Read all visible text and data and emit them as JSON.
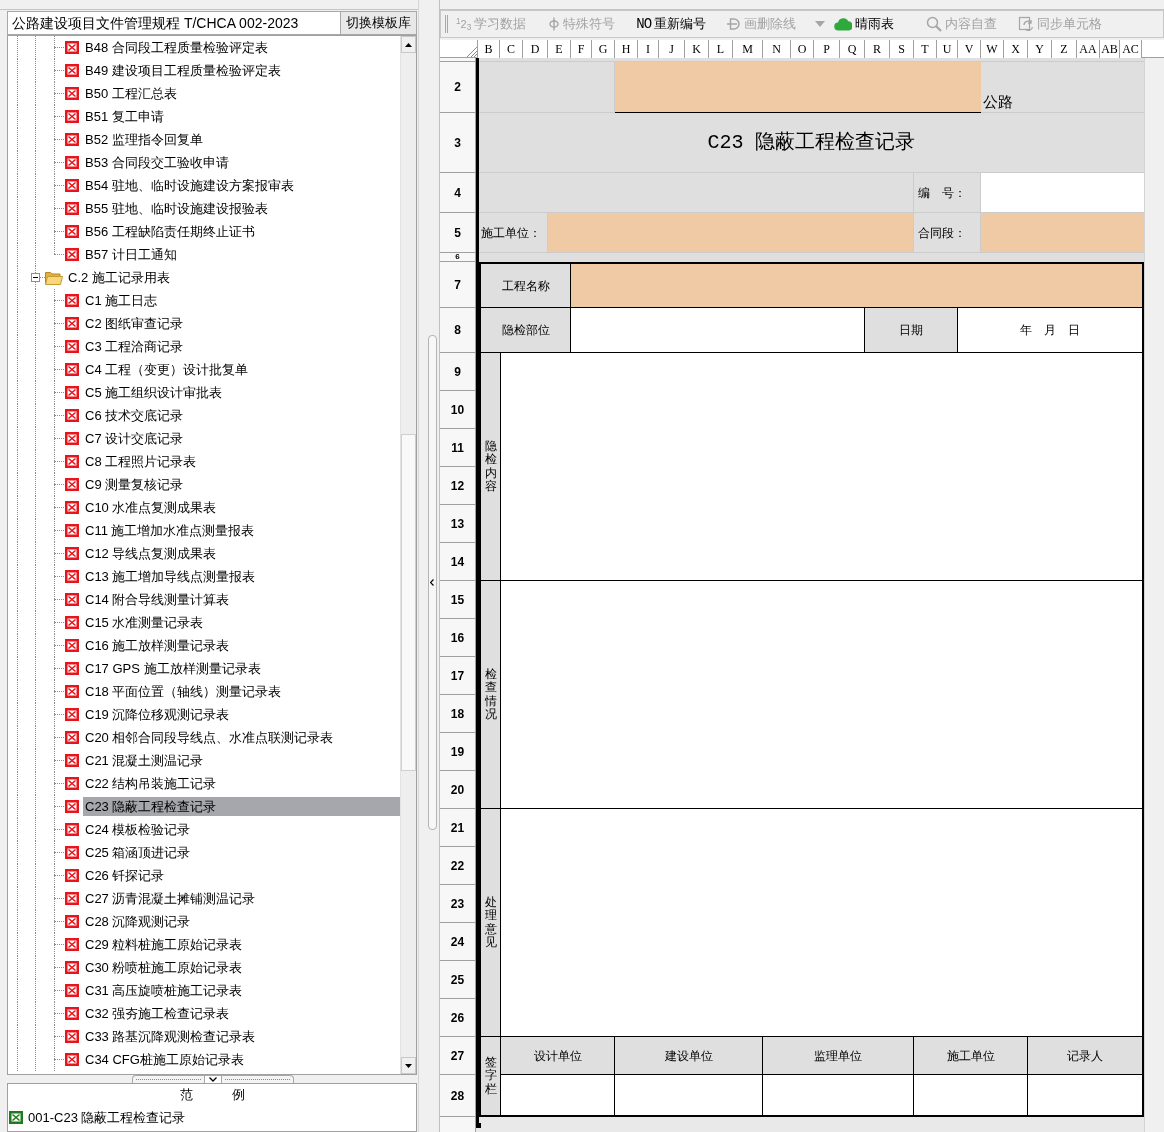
{
  "left_panel": {
    "library": {
      "value": "公路建设项目文件管理规程 T/CHCA 002-2023",
      "button": "切换模板库"
    },
    "tree": [
      {
        "kind": "continued",
        "children": [
          {
            "kind": "form",
            "label": "B48 合同段工程质量检验评定表",
            "selected": false
          },
          {
            "kind": "form",
            "label": "B49 建设项目工程质量检验评定表",
            "selected": false
          },
          {
            "kind": "form",
            "label": "B50 工程汇总表",
            "selected": false
          },
          {
            "kind": "form",
            "label": "B51 复工申请",
            "selected": false
          },
          {
            "kind": "form",
            "label": "B52 监理指令回复单",
            "selected": false
          },
          {
            "kind": "form",
            "label": "B53 合同段交工验收申请",
            "selected": false
          },
          {
            "kind": "form",
            "label": "B54 驻地、临时设施建设方案报审表",
            "selected": false
          },
          {
            "kind": "form",
            "label": "B55 驻地、临时设施建设报验表",
            "selected": false
          },
          {
            "kind": "form",
            "label": "B56 工程缺陷责任期终止证书",
            "selected": false
          },
          {
            "kind": "form",
            "label": "B57 计日工通知",
            "selected": false
          }
        ]
      },
      {
        "kind": "folder",
        "label": "C.2 施工记录用表",
        "expanded": true,
        "selected": false,
        "children": [
          {
            "kind": "form",
            "label": "C1 施工日志",
            "selected": false
          },
          {
            "kind": "form",
            "label": "C2 图纸审查记录",
            "selected": false
          },
          {
            "kind": "form",
            "label": "C3 工程洽商记录",
            "selected": false
          },
          {
            "kind": "form",
            "label": "C4 工程（变更）设计批复单",
            "selected": false
          },
          {
            "kind": "form",
            "label": "C5 施工组织设计审批表",
            "selected": false
          },
          {
            "kind": "form",
            "label": "C6 技术交底记录",
            "selected": false
          },
          {
            "kind": "form",
            "label": "C7 设计交底记录",
            "selected": false
          },
          {
            "kind": "form",
            "label": "C8 工程照片记录表",
            "selected": false
          },
          {
            "kind": "form",
            "label": "C9 测量复核记录",
            "selected": false
          },
          {
            "kind": "form",
            "label": "C10 水准点复测成果表",
            "selected": false
          },
          {
            "kind": "form",
            "label": "C11 施工增加水准点测量报表",
            "selected": false
          },
          {
            "kind": "form",
            "label": "C12 导线点复测成果表",
            "selected": false
          },
          {
            "kind": "form",
            "label": "C13 施工增加导线点测量报表",
            "selected": false
          },
          {
            "kind": "form",
            "label": "C14 附合导线测量计算表",
            "selected": false
          },
          {
            "kind": "form",
            "label": "C15 水准测量记录表",
            "selected": false
          },
          {
            "kind": "form",
            "label": "C16 施工放样测量记录表",
            "selected": false
          },
          {
            "kind": "form",
            "label": "C17 GPS 施工放样测量记录表",
            "selected": false
          },
          {
            "kind": "form",
            "label": "C18 平面位置（轴线）测量记录表",
            "selected": false
          },
          {
            "kind": "form",
            "label": "C19 沉降位移观测记录表",
            "selected": false
          },
          {
            "kind": "form",
            "label": "C20 相邻合同段导线点、水准点联测记录表",
            "selected": false
          },
          {
            "kind": "form",
            "label": "C21 混凝土测温记录",
            "selected": false
          },
          {
            "kind": "form",
            "label": "C22 结构吊装施工记录",
            "selected": false
          },
          {
            "kind": "form",
            "label": "C23 隐蔽工程检查记录",
            "selected": true
          },
          {
            "kind": "form",
            "label": "C24 模板检验记录",
            "selected": false
          },
          {
            "kind": "form",
            "label": "C25 箱涵顶进记录",
            "selected": false
          },
          {
            "kind": "form",
            "label": "C26 钎探记录",
            "selected": false
          },
          {
            "kind": "form",
            "label": "C27 沥青混凝土摊铺测温记录",
            "selected": false
          },
          {
            "kind": "form",
            "label": "C28 沉降观测记录",
            "selected": false
          },
          {
            "kind": "form",
            "label": "C29 粒料桩施工原始记录表",
            "selected": false
          },
          {
            "kind": "form",
            "label": "C30 粉喷桩施工原始记录表",
            "selected": false
          },
          {
            "kind": "form",
            "label": "C31 高压旋喷桩施工记录表",
            "selected": false
          },
          {
            "kind": "form",
            "label": "C32 强夯施工检查记录表",
            "selected": false
          },
          {
            "kind": "form",
            "label": "C33 路基沉降观测检查记录表",
            "selected": false
          },
          {
            "kind": "form",
            "label": "C34 CFG桩施工原始记录表",
            "selected": false
          }
        ]
      }
    ],
    "examples": {
      "title": "范　　　例",
      "items": [
        {
          "label": "001-C23 隐蔽工程检查记录"
        }
      ]
    }
  },
  "toolbar": [
    {
      "kind": "digits",
      "badge": "$^{1}$2$_{3}$",
      "label": "学习数据",
      "disabled": true
    },
    {
      "kind": "symbol",
      "label": "特殊符号",
      "disabled": true
    },
    {
      "kind": "numbering",
      "badge": "NO",
      "label": "重新编号",
      "disabled": false
    },
    {
      "kind": "strike",
      "label": "画删除线",
      "disabled": true
    },
    {
      "kind": "dropdown",
      "disabled": true
    },
    {
      "kind": "weather",
      "label": "晴雨表",
      "disabled": false
    },
    {
      "kind": "inspect",
      "label": "内容自查",
      "disabled": true
    },
    {
      "kind": "sync",
      "label": "同步单元格",
      "disabled": true
    }
  ],
  "sheet": {
    "columns": [
      "B",
      "C",
      "D",
      "E",
      "F",
      "G",
      "H",
      "I",
      "J",
      "K",
      "L",
      "M",
      "N",
      "O",
      "P",
      "Q",
      "R",
      "S",
      "T",
      "U",
      "V",
      "W",
      "X",
      "Y",
      "Z",
      "AA",
      "AB",
      "AC"
    ],
    "rows": [
      "2",
      "3",
      "4",
      "5",
      "6",
      "7",
      "8",
      "9",
      "10",
      "11",
      "12",
      "13",
      "14",
      "15",
      "16",
      "17",
      "18",
      "19",
      "20",
      "21",
      "22",
      "23",
      "24",
      "25",
      "26",
      "27",
      "28"
    ],
    "form": {
      "road_field": {
        "highlighted": true
      },
      "road_suffix": "公路",
      "title": "C23 隐蔽工程检查记录",
      "number_label": "编　号：",
      "number_field": {
        "highlighted": false
      },
      "contractor_label": "施工单位：",
      "contractor_field": {
        "highlighted": true
      },
      "section_label": "合同段：",
      "section_field": {
        "highlighted": true
      },
      "project_label": "工程名称",
      "project_field": {
        "highlighted": true
      },
      "location_label": "隐检部位",
      "location_field": {
        "highlighted": false
      },
      "date_label": "日期",
      "date_field": {
        "value": "年　月　日",
        "highlighted": false
      },
      "sections": [
        {
          "label": "隐检内容"
        },
        {
          "label": "检查情况"
        },
        {
          "label": "处理意见"
        }
      ],
      "signature": {
        "label": "签字栏",
        "columns": [
          "设计单位",
          "建设单位",
          "监理单位",
          "施工单位",
          "记录人"
        ]
      }
    }
  }
}
